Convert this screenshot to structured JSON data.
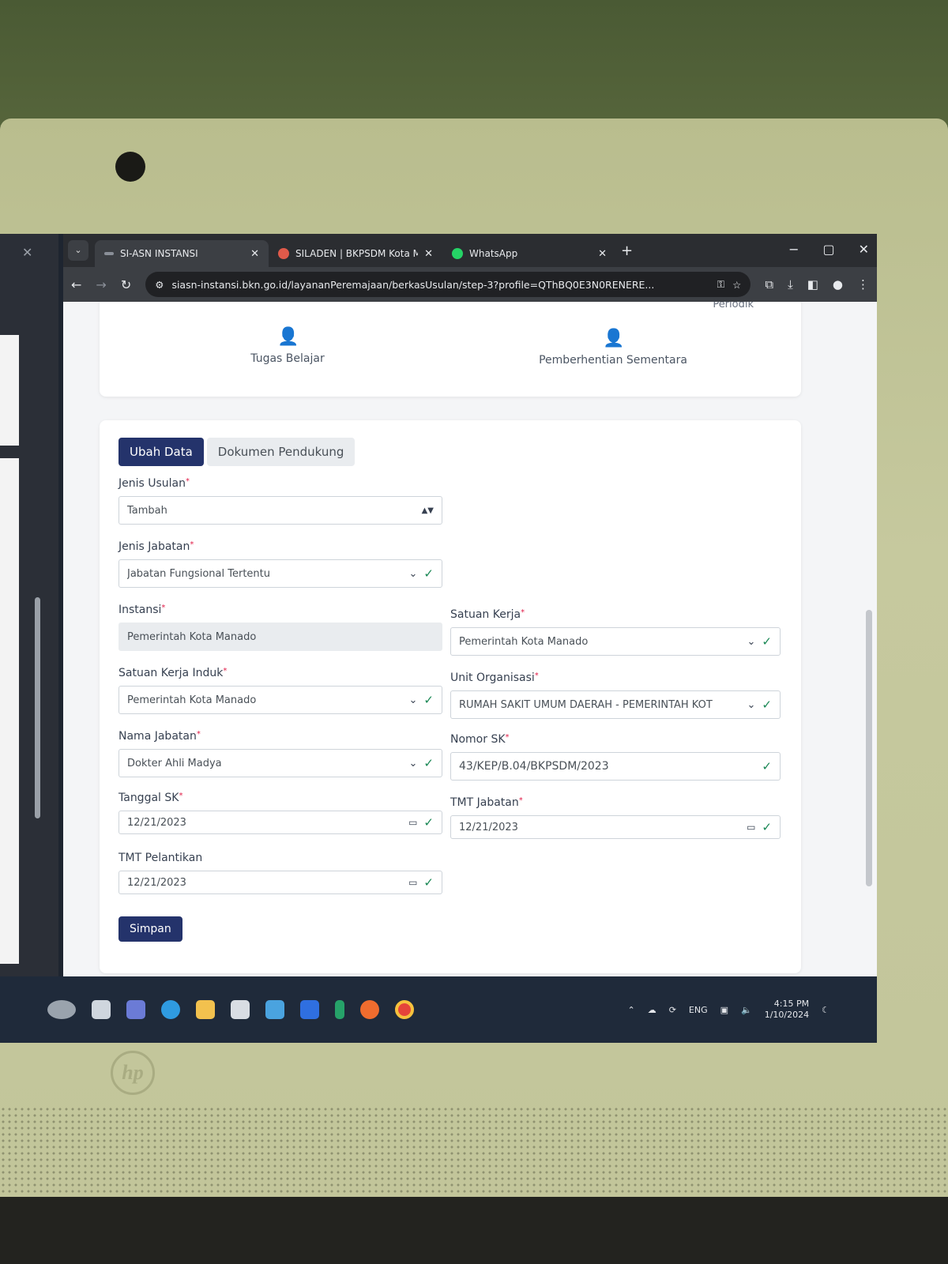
{
  "browser": {
    "tabs": [
      {
        "label": "SI-ASN INSTANSI",
        "favicon_color": "#8a8f98",
        "active": true
      },
      {
        "label": "SILADEN | BKPSDM Kota Mana",
        "favicon_color": "#e05a4a",
        "active": false
      },
      {
        "label": "WhatsApp",
        "favicon_color": "#25d366",
        "active": false
      }
    ],
    "url": "siasn-instansi.bkn.go.id/layananPeremajaan/berkasUsulan/step-3?profile=QThBQ0E3N0RENERE..."
  },
  "top_menu": {
    "periodik": "Periodik",
    "items": [
      {
        "label": "Tugas Belajar",
        "icon": "user-check-icon"
      },
      {
        "label": "Pemberhentian Sementara",
        "icon": "user-check-icon"
      }
    ]
  },
  "form": {
    "tabs": [
      {
        "label": "Ubah Data",
        "active": true
      },
      {
        "label": "Dokumen Pendukung",
        "active": false
      }
    ],
    "required_mark": "*",
    "fields": {
      "jenis_usulan": {
        "label": "Jenis Usulan",
        "value": "Tambah"
      },
      "jenis_jabatan": {
        "label": "Jenis Jabatan",
        "value": "Jabatan Fungsional Tertentu"
      },
      "instansi": {
        "label": "Instansi",
        "value": "Pemerintah Kota Manado"
      },
      "satuan_kerja": {
        "label": "Satuan Kerja",
        "value": "Pemerintah Kota Manado"
      },
      "satuan_kerja_induk": {
        "label": "Satuan Kerja Induk",
        "value": "Pemerintah Kota Manado"
      },
      "unit_organisasi": {
        "label": "Unit Organisasi",
        "value": "RUMAH SAKIT UMUM DAERAH - PEMERINTAH KOT"
      },
      "nama_jabatan": {
        "label": "Nama Jabatan",
        "value": "Dokter Ahli Madya"
      },
      "nomor_sk": {
        "label": "Nomor SK",
        "value": "43/KEP/B.04/BKPSDM/2023"
      },
      "tanggal_sk": {
        "label": "Tanggal SK",
        "value": "12/21/2023"
      },
      "tmt_jabatan": {
        "label": "TMT Jabatan",
        "value": "12/21/2023"
      },
      "tmt_pelantikan": {
        "label": "TMT Pelantikan",
        "value": "12/21/2023"
      }
    },
    "save_label": "Simpan"
  },
  "taskbar": {
    "language": "ENG",
    "time": "4:15 PM",
    "date": "1/10/2024"
  },
  "colors": {
    "primary": "#24336b",
    "valid": "#198754"
  }
}
